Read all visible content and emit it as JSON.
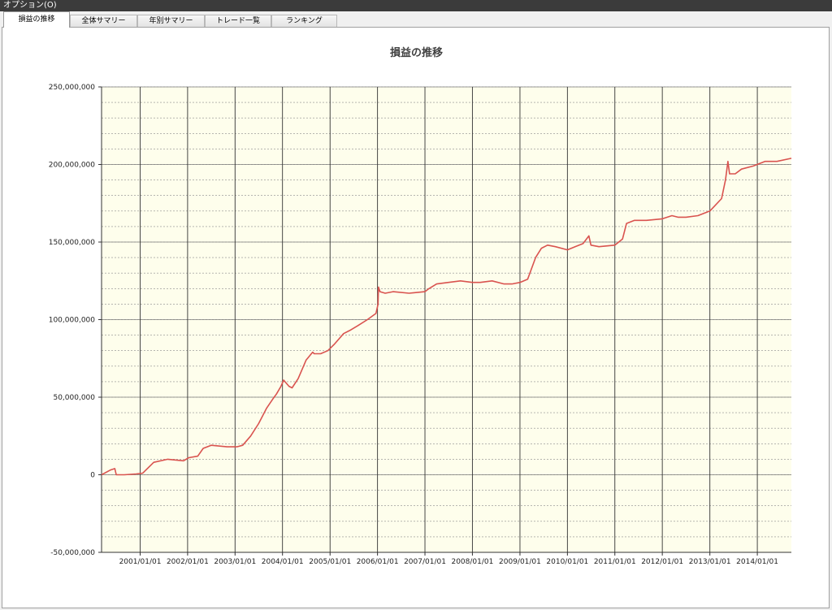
{
  "menubar": {
    "options_label": "オプション(O)"
  },
  "tabs": [
    {
      "label": "損益の推移",
      "active": true
    },
    {
      "label": "全体サマリー",
      "active": false
    },
    {
      "label": "年別サマリー",
      "active": false
    },
    {
      "label": "トレード一覧",
      "active": false
    },
    {
      "label": "ランキング",
      "active": false
    }
  ],
  "colors": {
    "plot_background": "#fefeec",
    "series_line": "#d9534f",
    "menubar": "#3b3b3b"
  },
  "chart_data": {
    "type": "line",
    "title": "損益の推移",
    "xlabel": "",
    "ylabel": "",
    "xlim": [
      "2000-03-10",
      "2014-09-20"
    ],
    "ylim": [
      -50000000,
      250000000
    ],
    "y_major_ticks": [
      -50000000,
      0,
      50000000,
      100000000,
      150000000,
      200000000,
      250000000
    ],
    "y_tick_labels": [
      "-50,000,000",
      "0",
      "50,000,000",
      "100,000,000",
      "150,000,000",
      "200,000,000",
      "250,000,000"
    ],
    "x_tick_labels": [
      "2001/01/01",
      "2002/01/01",
      "2003/01/01",
      "2004/01/01",
      "2005/01/01",
      "2006/01/01",
      "2007/01/01",
      "2008/01/01",
      "2009/01/01",
      "2010/01/01",
      "2011/01/01",
      "2012/01/01",
      "2013/01/01",
      "2014/01/01"
    ],
    "grid": true,
    "series": [
      {
        "x": [
          "2000-03-10",
          "2000-05-15",
          "2000-06-20",
          "2000-07-01",
          "2000-09-01",
          "2000-12-01",
          "2001-01-20",
          "2001-04-15",
          "2001-08-01",
          "2001-12-01",
          "2002-01-10",
          "2002-03-20",
          "2002-05-01",
          "2002-07-01",
          "2002-11-01",
          "2003-01-15",
          "2003-03-01",
          "2003-05-01",
          "2003-07-01",
          "2003-09-01",
          "2003-10-20",
          "2003-11-15",
          "2003-12-20",
          "2004-01-10",
          "2004-02-20",
          "2004-03-15",
          "2004-05-01",
          "2004-07-01",
          "2004-08-20",
          "2004-09-01",
          "2004-10-20",
          "2004-12-15",
          "2005-02-01",
          "2005-04-15",
          "2005-06-01",
          "2005-08-01",
          "2005-10-15",
          "2005-12-20",
          "2006-01-05",
          "2006-01-08",
          "2006-01-20",
          "2006-03-01",
          "2006-05-01",
          "2006-09-01",
          "2007-01-01",
          "2007-02-01",
          "2007-04-01",
          "2007-07-01",
          "2007-10-01",
          "2008-01-01",
          "2008-03-01",
          "2008-06-01",
          "2008-09-01",
          "2008-11-01",
          "2009-01-01",
          "2009-03-01",
          "2009-05-01",
          "2009-06-15",
          "2009-08-01",
          "2009-10-01",
          "2010-01-01",
          "2010-03-01",
          "2010-05-01",
          "2010-06-15",
          "2010-07-01",
          "2010-09-01",
          "2011-01-01",
          "2011-03-01",
          "2011-04-01",
          "2011-06-01",
          "2011-09-01",
          "2012-01-01",
          "2012-03-15",
          "2012-05-01",
          "2012-07-01",
          "2012-10-01",
          "2013-01-01",
          "2013-04-01",
          "2013-05-01",
          "2013-05-20",
          "2013-06-01",
          "2013-07-15",
          "2013-09-01",
          "2013-12-01",
          "2014-03-01",
          "2014-06-01",
          "2014-09-20"
        ],
        "values": [
          0,
          3000000,
          4000000,
          0,
          0,
          500000,
          1000000,
          8000000,
          10000000,
          9000000,
          11000000,
          12000000,
          17000000,
          19000000,
          18000000,
          18000000,
          19000000,
          25000000,
          33000000,
          43000000,
          49000000,
          52000000,
          57000000,
          61000000,
          57000000,
          56000000,
          62000000,
          74000000,
          79000000,
          78000000,
          78000000,
          80000000,
          84000000,
          91000000,
          93000000,
          96000000,
          100000000,
          104000000,
          110000000,
          121000000,
          118000000,
          117000000,
          118000000,
          117000000,
          118000000,
          120000000,
          123000000,
          124000000,
          125000000,
          124000000,
          124000000,
          125000000,
          123000000,
          123000000,
          124000000,
          126000000,
          140000000,
          146000000,
          148000000,
          147000000,
          145000000,
          147000000,
          149000000,
          154000000,
          148000000,
          147000000,
          148000000,
          152000000,
          162000000,
          164000000,
          164000000,
          165000000,
          167000000,
          166000000,
          166000000,
          167000000,
          170000000,
          178000000,
          190000000,
          202000000,
          194000000,
          194000000,
          197000000,
          199000000,
          202000000,
          202000000,
          204000000
        ]
      }
    ]
  }
}
